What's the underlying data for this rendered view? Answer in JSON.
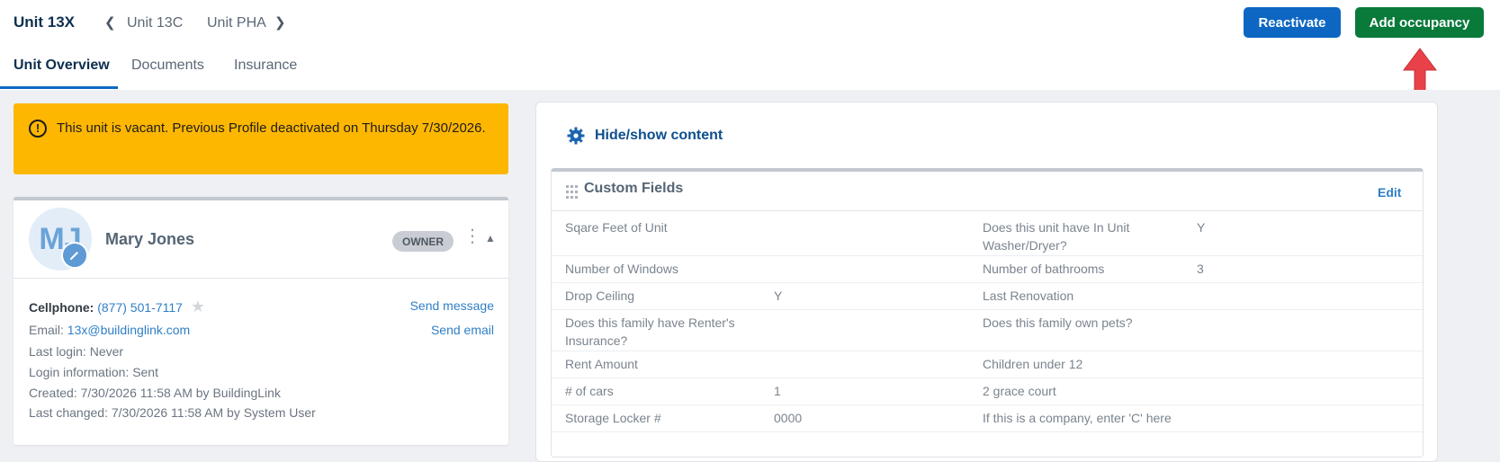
{
  "header": {
    "unit_title": "Unit 13X",
    "prev_unit": "Unit 13C",
    "next_unit": "Unit PHA",
    "reactivate_label": "Reactivate",
    "add_occupancy_label": "Add occupancy"
  },
  "tabs": [
    {
      "label": "Unit Overview",
      "active": true
    },
    {
      "label": "Documents",
      "active": false
    },
    {
      "label": "Insurance",
      "active": false
    }
  ],
  "alert": {
    "text": "This unit is vacant. Previous Profile deactivated on Thursday 7/30/2026."
  },
  "profile": {
    "initials": "MJ",
    "name": "Mary Jones",
    "role_badge": "OWNER",
    "cellphone_label": "Cellphone:",
    "cellphone": "(877) 501-7117",
    "send_message": "Send message",
    "email_label": "Email:",
    "email": "13x@buildinglink.com",
    "send_email": "Send email",
    "last_login_label": "Last login:",
    "last_login": "Never",
    "login_info_label": "Login information:",
    "login_info": "Sent",
    "created_label": "Created:",
    "created": "7/30/2026 11:58 AM by BuildingLink",
    "last_changed_label": "Last changed:",
    "last_changed": "7/30/2026 11:58 AM by System User"
  },
  "panel": {
    "hide_show_label": "Hide/show content",
    "custom_fields_title": "Custom Fields",
    "edit_label": "Edit",
    "fields": [
      {
        "label": "Sqare Feet of Unit",
        "value": ""
      },
      {
        "label": "Does this unit have In Unit Washer/Dryer?",
        "value": "Y"
      },
      {
        "label": "Number of Windows",
        "value": ""
      },
      {
        "label": "Number of bathrooms",
        "value": "3"
      },
      {
        "label": "Drop Ceiling",
        "value": "Y"
      },
      {
        "label": "Last Renovation",
        "value": ""
      },
      {
        "label": "Does this family have Renter's Insurance?",
        "value": ""
      },
      {
        "label": "Does this family own pets?",
        "value": ""
      },
      {
        "label": "Rent Amount",
        "value": ""
      },
      {
        "label": "Children under 12",
        "value": ""
      },
      {
        "label": "# of cars",
        "value": "1"
      },
      {
        "label": "2 grace court",
        "value": ""
      },
      {
        "label": "Storage Locker #",
        "value": "0000"
      },
      {
        "label": "If this is a company, enter 'C' here",
        "value": ""
      }
    ]
  },
  "colors": {
    "primary_blue": "#0d67c2",
    "success_green": "#0a7a3b",
    "alert_yellow": "#fdb700",
    "annotation_red": "#e8414a"
  },
  "icons": [
    "chevron-left-icon",
    "chevron-right-icon",
    "alert-circle-icon",
    "pencil-icon",
    "star-icon",
    "kebab-icon",
    "caret-up-icon",
    "gear-icon",
    "grip-icon",
    "red-arrow-annotation"
  ]
}
